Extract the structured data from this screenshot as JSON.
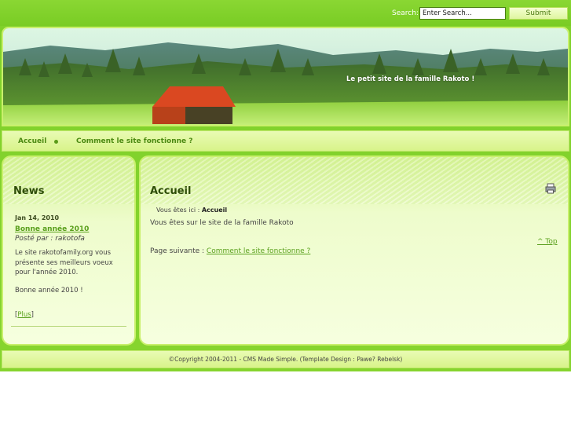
{
  "search": {
    "label": "Search:",
    "placeholder": "Enter Search...",
    "value": "Enter Search...",
    "submit_label": "Submit"
  },
  "header": {
    "site_title": "Le petit site de la famille Rakoto !"
  },
  "nav": {
    "items": [
      {
        "label": "Accueil"
      },
      {
        "label": "Comment le site fonctionne ?"
      }
    ]
  },
  "sidebar": {
    "heading": "News",
    "news": {
      "date": "Jan 14, 2010",
      "title": "Bonne année 2010",
      "author": "Posté par : rakotofa",
      "body": "Le site rakotofamily.org vous présente ses meilleurs voeux pour l'année 2010.",
      "body2": "Bonne année 2010 !",
      "more_open": "[",
      "more_label": "Plus",
      "more_close": "]"
    }
  },
  "main": {
    "heading": "Accueil",
    "breadcrumb_prefix": "Vous êtes ici : ",
    "breadcrumb_current": "Accueil",
    "text": "Vous êtes sur le site de la famille Rakoto",
    "top_link": "^ Top",
    "next_label": "Page suivante : ",
    "next_link": "Comment le site fonctionne ?"
  },
  "footer": {
    "text": "©Copyright 2004-2011 - CMS Made Simple. (Template Design : Pawe? Rebelsk)"
  },
  "colors": {
    "accent": "#7fd12a",
    "link": "#5aa01d",
    "heading": "#2e4d09",
    "panel": "#eefccc",
    "roof": "#e0321a"
  }
}
